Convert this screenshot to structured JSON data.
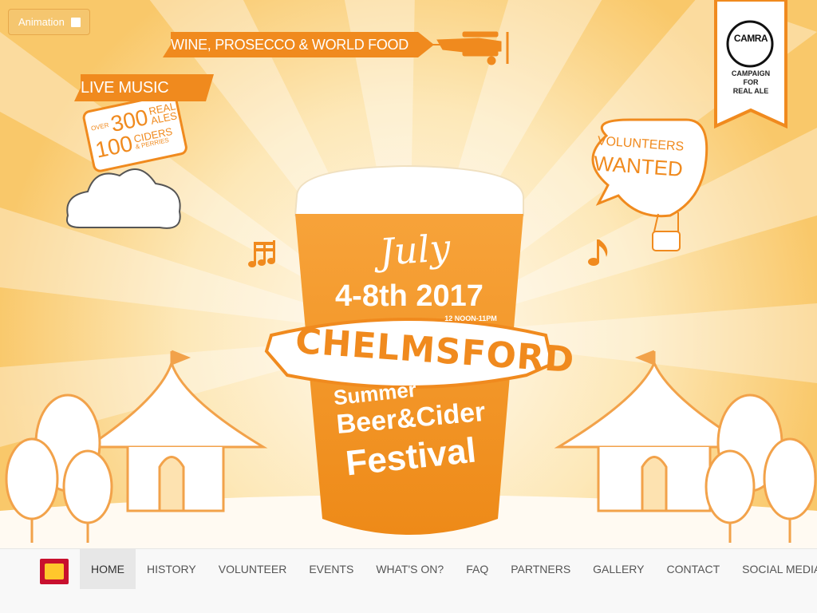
{
  "animation_toggle": {
    "label": "Animation",
    "checked": false
  },
  "banners": {
    "wine": "WINE, PROSECCO & WORLD FOOD",
    "music": "LIVE MUSIC"
  },
  "ales_badge": {
    "over": "OVER",
    "count_ales": "300",
    "ales_label_1": "REAL",
    "ales_label_2": "ALES",
    "count_ciders": "100",
    "ciders_label": "CIDERS",
    "perries_label": "& PERRIES"
  },
  "camra": {
    "logo_text": "CAMRA",
    "line1": "CAMPAIGN",
    "line2": "FOR",
    "line3": "REAL ALE"
  },
  "volunteers": {
    "line1": "VOLUNTEERS",
    "line2": "WANTED"
  },
  "festival": {
    "month": "July",
    "dates": "4-8th 2017",
    "hours": "12 NOON-11PM",
    "city": "CHELMSFORD",
    "line1": "Summer",
    "line2": "Beer&Cider",
    "line3": "Festival"
  },
  "colors": {
    "accent": "#f08a1e",
    "sky": "#fcd98a",
    "nav_bg": "#f8f8f8"
  },
  "nav": {
    "items": [
      {
        "label": "HOME",
        "active": true
      },
      {
        "label": "HISTORY"
      },
      {
        "label": "VOLUNTEER"
      },
      {
        "label": "EVENTS"
      },
      {
        "label": "WHAT'S ON?"
      },
      {
        "label": "FAQ"
      },
      {
        "label": "PARTNERS"
      },
      {
        "label": "GALLERY"
      },
      {
        "label": "CONTACT"
      },
      {
        "label": "SOCIAL MEDIA",
        "dropdown": true
      }
    ]
  }
}
